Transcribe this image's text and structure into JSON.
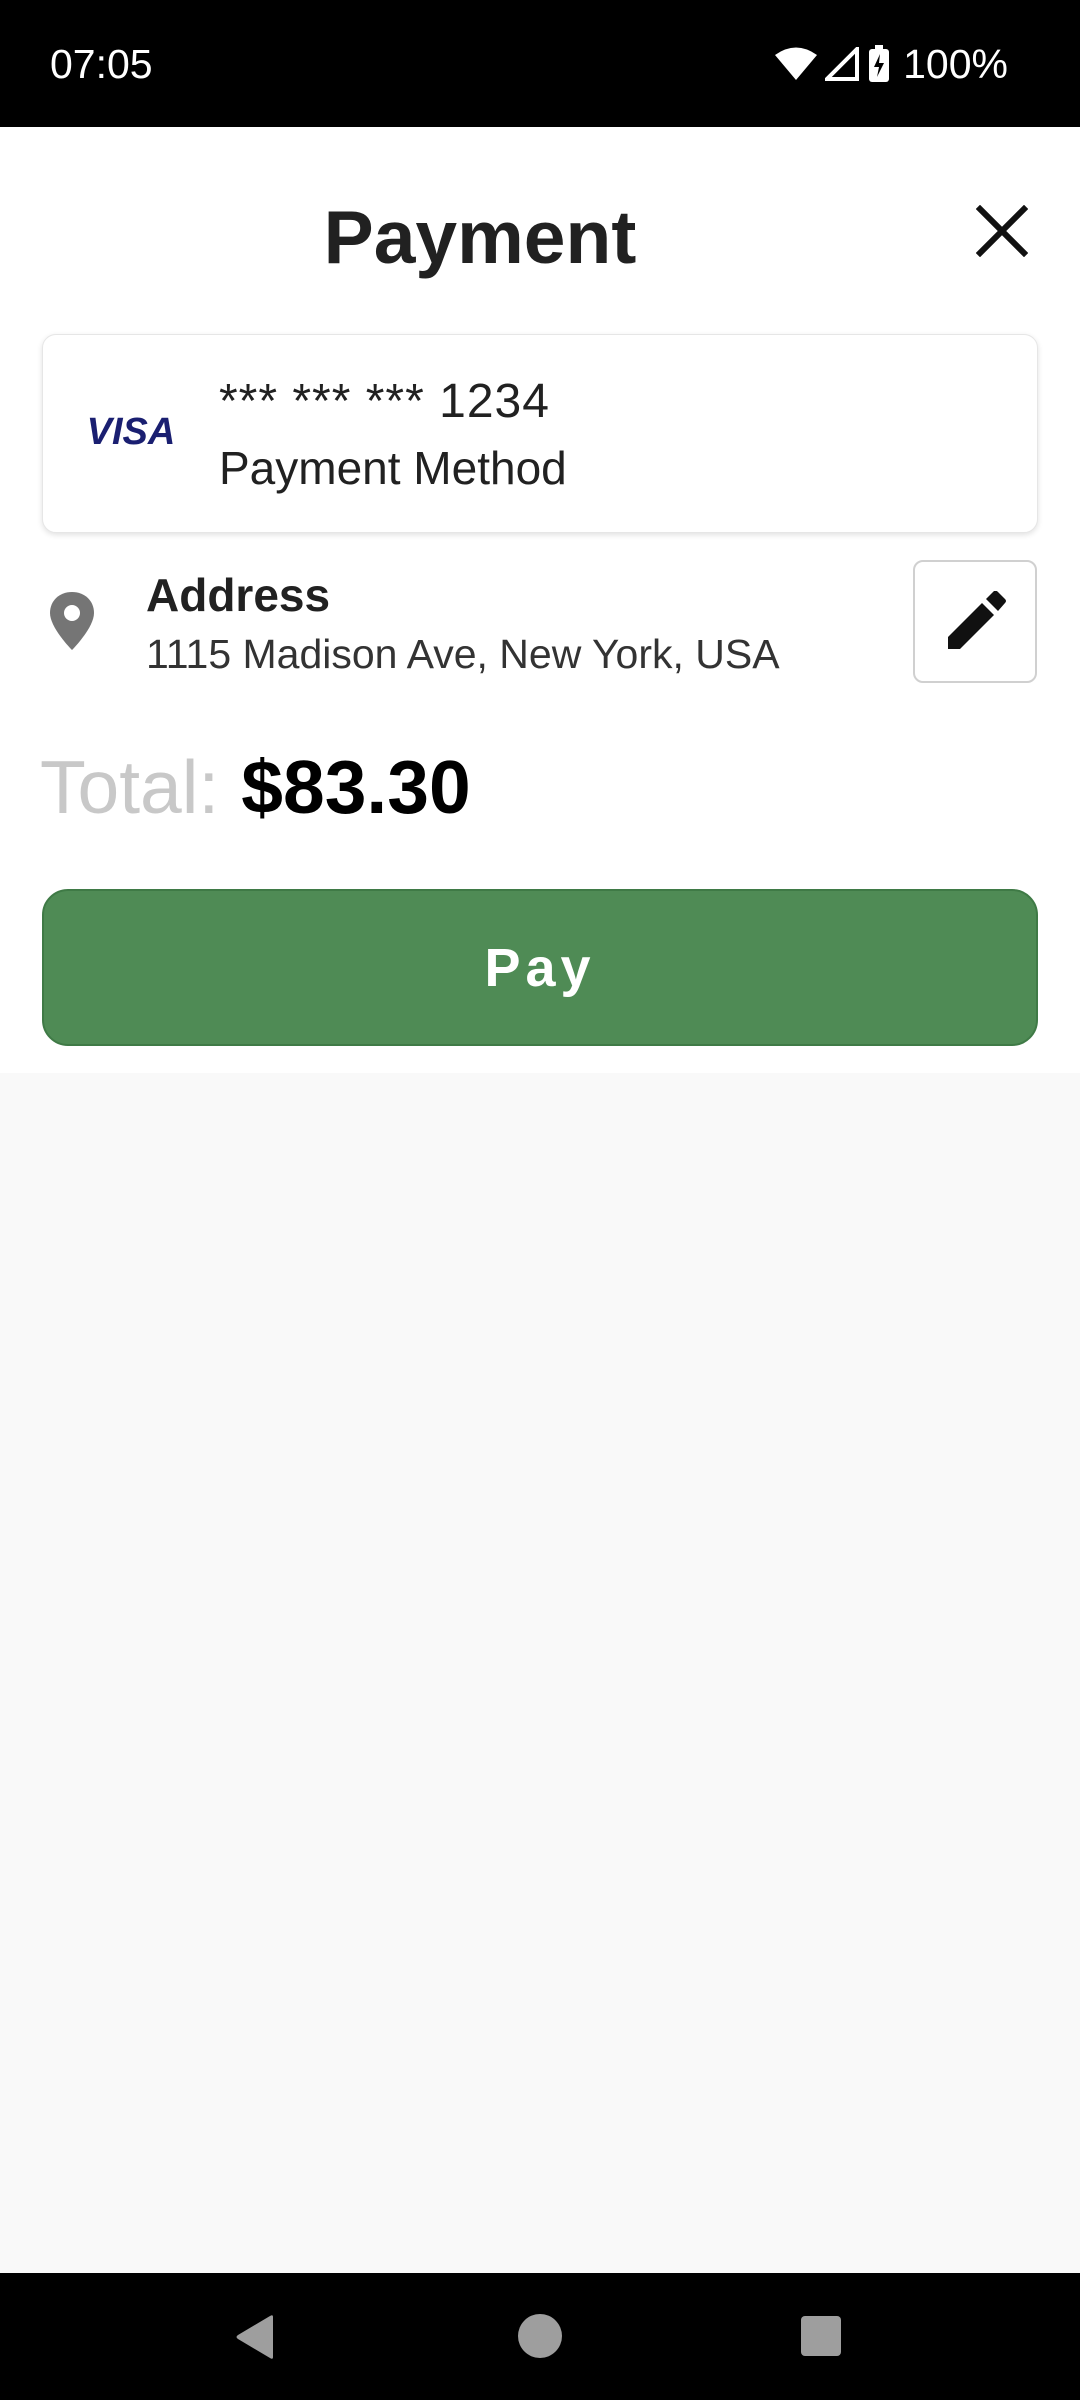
{
  "status_bar": {
    "time": "07:05",
    "battery": "100%",
    "icons": [
      "wifi-icon",
      "cell-signal-icon",
      "battery-charging-icon"
    ]
  },
  "header": {
    "title": "Payment",
    "close_icon": "close-icon"
  },
  "payment_card": {
    "brand": "VISA",
    "number": "*** *** *** 1234",
    "subtitle": "Payment Method"
  },
  "address": {
    "label": "Address",
    "value": "1115 Madison Ave, New York, USA",
    "edit_icon": "pencil-icon"
  },
  "total": {
    "label": "Total:",
    "value": "$83.30"
  },
  "pay_button": {
    "label": "Pay"
  },
  "colors": {
    "pay_green": "#4f8b55",
    "visa_blue": "#1a1f71"
  },
  "nav_bar": {
    "icons": [
      "back-icon",
      "home-icon",
      "recents-icon"
    ]
  }
}
